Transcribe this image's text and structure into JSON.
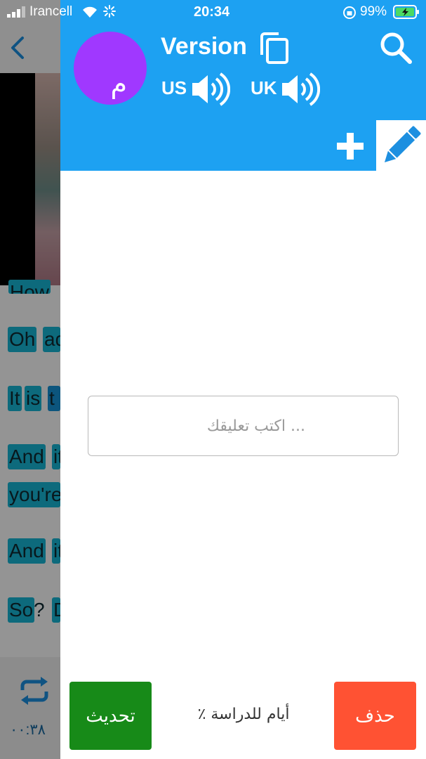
{
  "status_bar": {
    "carrier": "Irancell",
    "time": "20:34",
    "battery_percent": "99%"
  },
  "background_app": {
    "lines": [
      {
        "words": [
          "How"
        ]
      },
      {
        "words": [
          "Oh",
          "ad"
        ]
      },
      {
        "words": [
          "It",
          "is",
          "t"
        ]
      },
      {
        "words": [
          "And",
          "it"
        ]
      },
      {
        "words": [
          "you're"
        ]
      },
      {
        "words": [
          "And",
          "it"
        ]
      },
      {
        "words": [
          "So",
          "D"
        ],
        "between": "?"
      }
    ],
    "timer": "۰۰:۳۸"
  },
  "panel": {
    "avatar_letter": "م",
    "title": "Version",
    "us_label": "US",
    "uk_label": "UK",
    "comment_placeholder": "اكتب تعليقك ...",
    "update_label": "تحديث",
    "study_days": "٪ أيام للدراسة",
    "delete_label": "حذف"
  },
  "colors": {
    "header": "#1da1f2",
    "avatar": "#a038ff",
    "update": "#178a18",
    "delete": "#ff5233",
    "word_highlight": "#18b7d6"
  },
  "icons": [
    "back-icon",
    "copy-icon",
    "search-icon",
    "speaker-icon",
    "plus-icon",
    "pencil-icon",
    "repeat-icon",
    "wifi-icon",
    "battery-icon"
  ]
}
